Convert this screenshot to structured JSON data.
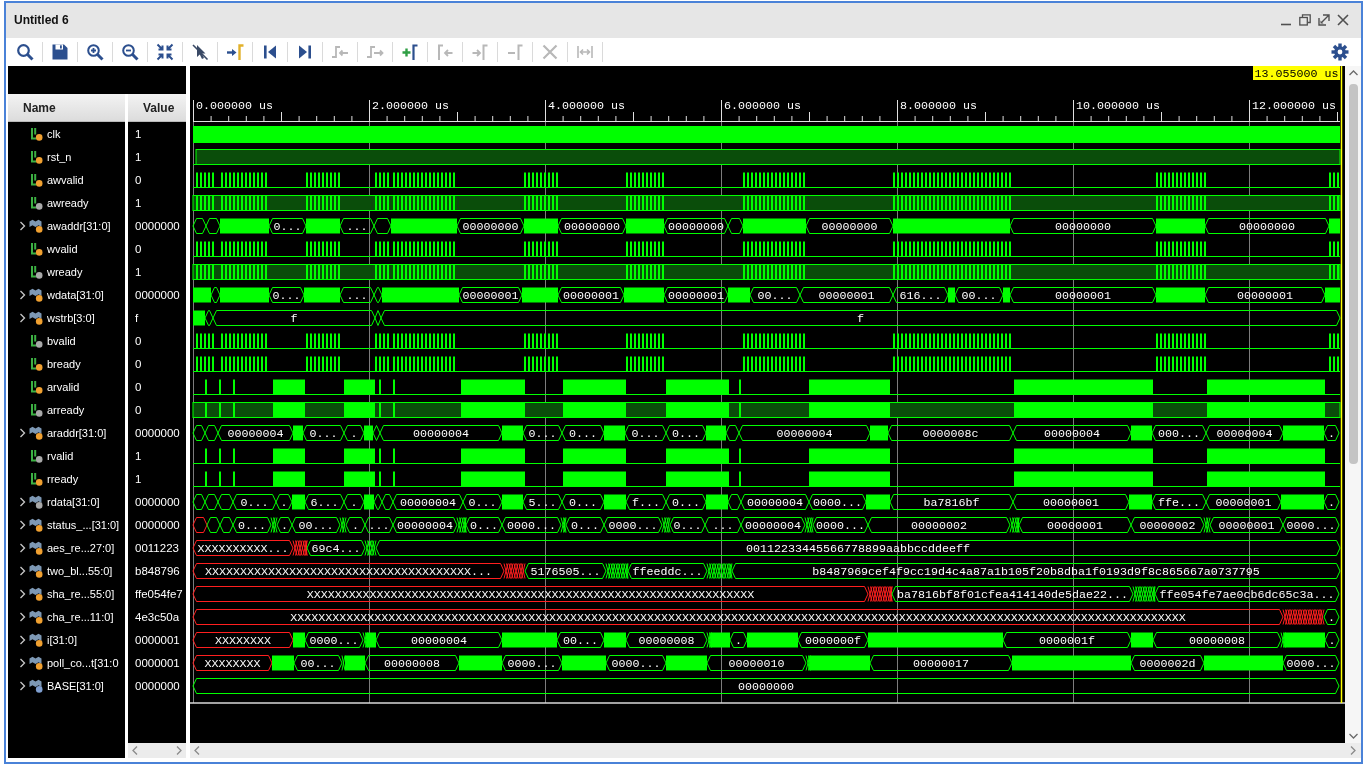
{
  "window": {
    "title": "Untitled 6"
  },
  "toolbar": [
    {
      "kind": "search",
      "disabled": false
    },
    {
      "kind": "save",
      "disabled": false
    },
    {
      "kind": "zoomin",
      "disabled": false
    },
    {
      "kind": "zoomout",
      "disabled": false
    },
    {
      "kind": "fit",
      "disabled": false
    },
    {
      "kind": "snap",
      "disabled": false
    },
    {
      "kind": "cursor",
      "disabled": false
    },
    {
      "kind": "first",
      "disabled": false
    },
    {
      "kind": "last",
      "disabled": false
    },
    {
      "kind": "prevedge",
      "disabled": true
    },
    {
      "kind": "nextedge",
      "disabled": true
    },
    {
      "kind": "addmarker",
      "disabled": false
    },
    {
      "kind": "prevmarker",
      "disabled": true
    },
    {
      "kind": "nextmarker",
      "disabled": true
    },
    {
      "kind": "removemarker",
      "disabled": true
    },
    {
      "kind": "clear",
      "disabled": true
    },
    {
      "kind": "distance",
      "disabled": true
    },
    {
      "kind": "settings",
      "disabled": false
    }
  ],
  "columns": {
    "name": "Name",
    "value": "Value"
  },
  "ruler": {
    "labels": [
      "0.000000 us",
      "2.000000 us",
      "4.000000 us",
      "6.000000 us",
      "8.000000 us",
      "10.000000 us",
      "12.000000 us"
    ],
    "cursor": "13.055000 us"
  },
  "signals": [
    {
      "name": "clk",
      "value": "1",
      "kind": "clock",
      "color": "#f0a030",
      "selected": false
    },
    {
      "name": "rst_n",
      "value": "1",
      "kind": "high",
      "color": "#f0a030",
      "selected": false
    },
    {
      "name": "awvalid",
      "value": "0",
      "kind": "bursts",
      "color": "#f0a030",
      "selected": false
    },
    {
      "name": "awready",
      "value": "1",
      "kind": "burstshigh",
      "color": "#a8a8a8",
      "selected": false
    },
    {
      "name": "awaddr[31:0]",
      "value": "0000000",
      "kind": "bus",
      "color": "#f0a030",
      "selected": false,
      "segments": [
        {
          "label": "0...",
          "kind": "valid"
        },
        {
          "label": "...",
          "kind": "valid"
        },
        {
          "label": "00000000",
          "kind": "valid"
        },
        {
          "label": "00000000",
          "kind": "valid"
        },
        {
          "label": "00000000",
          "kind": "valid"
        },
        {
          "label": "00000000",
          "kind": "valid"
        },
        {
          "label": "00000000",
          "kind": "valid"
        },
        {
          "label": "00000000",
          "kind": "valid"
        }
      ]
    },
    {
      "name": "wvalid",
      "value": "0",
      "kind": "bursts",
      "color": "#f0a030",
      "selected": false
    },
    {
      "name": "wready",
      "value": "1",
      "kind": "burstshigh",
      "color": "#a8a8a8",
      "selected": false
    },
    {
      "name": "wdata[31:0]",
      "value": "0000000",
      "kind": "bus",
      "color": "#f0a030",
      "selected": false,
      "segments": [
        {
          "label": "0...",
          "kind": "valid"
        },
        {
          "label": "...",
          "kind": "valid"
        },
        {
          "label": "00000001",
          "kind": "valid"
        },
        {
          "label": "00000001",
          "kind": "valid"
        },
        {
          "label": "00000001",
          "kind": "valid"
        },
        {
          "label": "00...",
          "kind": "valid"
        },
        {
          "label": "00000001",
          "kind": "valid"
        },
        {
          "label": "616...",
          "kind": "valid"
        },
        {
          "label": "00...",
          "kind": "valid"
        },
        {
          "label": "00000001",
          "kind": "valid"
        },
        {
          "label": "00000001",
          "kind": "valid"
        }
      ]
    },
    {
      "name": "wstrb[3:0]",
      "value": "f",
      "kind": "bus",
      "color": "#f0a030",
      "selected": false,
      "segments": [
        {
          "label": "f",
          "kind": "valid"
        },
        {
          "label": "f",
          "kind": "valid"
        }
      ]
    },
    {
      "name": "bvalid",
      "value": "0",
      "kind": "bursts",
      "color": "#a8a8a8",
      "selected": false
    },
    {
      "name": "bready",
      "value": "0",
      "kind": "bursts",
      "color": "#f0a030",
      "selected": false
    },
    {
      "name": "arvalid",
      "value": "0",
      "kind": "blocks",
      "color": "#f0a030",
      "selected": false
    },
    {
      "name": "arready",
      "value": "0",
      "kind": "blockshigh",
      "color": "#a8a8a8",
      "selected": false
    },
    {
      "name": "araddr[31:0]",
      "value": "0000000",
      "kind": "bus",
      "color": "#f0a030",
      "selected": false,
      "segments": [
        {
          "label": "00000004",
          "kind": "valid"
        },
        {
          "label": "0...",
          "kind": "valid"
        },
        {
          "label": ".",
          "kind": "valid"
        },
        {
          "label": "00000004",
          "kind": "valid"
        },
        {
          "label": "0...",
          "kind": "valid"
        },
        {
          "label": "0...",
          "kind": "valid"
        },
        {
          "label": "0...",
          "kind": "valid"
        },
        {
          "label": "0...",
          "kind": "valid"
        },
        {
          "label": "00000004",
          "kind": "valid"
        },
        {
          "label": "0000008c",
          "kind": "valid"
        },
        {
          "label": "00000004",
          "kind": "valid"
        },
        {
          "label": "000...",
          "kind": "valid"
        },
        {
          "label": "00000004",
          "kind": "valid"
        },
        {
          "label": ".",
          "kind": "valid"
        }
      ]
    },
    {
      "name": "rvalid",
      "value": "1",
      "kind": "blocks",
      "color": "#a8a8a8",
      "selected": false
    },
    {
      "name": "rready",
      "value": "1",
      "kind": "blocks",
      "color": "#f0a030",
      "selected": false
    },
    {
      "name": "rdata[31:0]",
      "value": "0000000",
      "kind": "bus",
      "color": "#a8a8a8",
      "selected": false,
      "segments": [
        {
          "label": "0...",
          "kind": "valid"
        },
        {
          "label": ".",
          "kind": "valid"
        },
        {
          "label": "6...",
          "kind": "valid"
        },
        {
          "label": ".",
          "kind": "valid"
        },
        {
          "label": "00000004",
          "kind": "valid"
        },
        {
          "label": "0...",
          "kind": "valid"
        },
        {
          "label": "5...",
          "kind": "valid"
        },
        {
          "label": "0...",
          "kind": "valid"
        },
        {
          "label": "f...",
          "kind": "valid"
        },
        {
          "label": "0...",
          "kind": "valid"
        },
        {
          "label": "00000004",
          "kind": "valid"
        },
        {
          "label": "0000...",
          "kind": "valid"
        },
        {
          "label": "ba7816bf",
          "kind": "valid"
        },
        {
          "label": "00000001",
          "kind": "valid"
        },
        {
          "label": "ffe...",
          "kind": "valid"
        },
        {
          "label": "00000001",
          "kind": "valid"
        },
        {
          "label": ".",
          "kind": "valid"
        }
      ]
    },
    {
      "name": "status_...[31:0]",
      "value": "0000000",
      "kind": "bus",
      "color": "#f0a030",
      "selected": false,
      "segments": [
        {
          "label": "0...",
          "kind": "valid"
        },
        {
          "label": ".",
          "kind": "valid"
        },
        {
          "label": "00...",
          "kind": "valid"
        },
        {
          "label": ".",
          "kind": "valid"
        },
        {
          "label": "...",
          "kind": "valid"
        },
        {
          "label": "00000004",
          "kind": "valid"
        },
        {
          "label": "0...",
          "kind": "valid"
        },
        {
          "label": "0000...",
          "kind": "valid"
        },
        {
          "label": "0...",
          "kind": "valid"
        },
        {
          "label": "0000...",
          "kind": "valid"
        },
        {
          "label": "0...",
          "kind": "valid"
        },
        {
          "label": "...",
          "kind": "valid"
        },
        {
          "label": "00000004",
          "kind": "valid"
        },
        {
          "label": "0000...",
          "kind": "valid"
        },
        {
          "label": "00000002",
          "kind": "valid"
        },
        {
          "label": "00000001",
          "kind": "valid"
        },
        {
          "label": "00000002",
          "kind": "valid"
        },
        {
          "label": "00000001",
          "kind": "valid"
        },
        {
          "label": "0000...",
          "kind": "valid"
        }
      ]
    },
    {
      "name": "aes_re...27:0]",
      "value": "0011223",
      "kind": "bus",
      "color": "#f0a030",
      "selected": false,
      "segments": [
        {
          "label": "XXXXXXXXXX...",
          "kind": "unknown"
        },
        {
          "label": "69c4...",
          "kind": "valid"
        },
        {
          "label": "00112233445566778899aabbccddeeff",
          "kind": "valid"
        }
      ]
    },
    {
      "name": "two_bl...55:0]",
      "value": "b848796",
      "kind": "bus",
      "color": "#f0a030",
      "selected": false,
      "segments": [
        {
          "label": "XXXXXXXXXXXXXXXXXXXXXXXXXXXXXXXXXXXXXX...",
          "kind": "unknown"
        },
        {
          "label": "5176505...",
          "kind": "valid"
        },
        {
          "label": "ffeeddc...",
          "kind": "valid"
        },
        {
          "label": "b8487969cef4f9cc19d4c4a87a1b105f20b8dba1f0193d9f8c865667a0737795",
          "kind": "valid"
        }
      ]
    },
    {
      "name": "sha_re...55:0]",
      "value": "ffe054fe7",
      "kind": "bus",
      "color": "#f0a030",
      "selected": false,
      "segments": [
        {
          "label": "XXXXXXXXXXXXXXXXXXXXXXXXXXXXXXXXXXXXXXXXXXXXXXXXXXXXXXXXXXXXXXXX",
          "kind": "unknown"
        },
        {
          "label": "ba7816bf8f01cfea414140de5dae22...",
          "kind": "valid"
        },
        {
          "label": "ffe054fe7ae0cb6dc65c3a...",
          "kind": "valid"
        }
      ]
    },
    {
      "name": "cha_re...11:0]",
      "value": "4e3c50a",
      "kind": "bus",
      "color": "#f0a030",
      "selected": false,
      "segments": [
        {
          "label": "XXXXXXXXXXXXXXXXXXXXXXXXXXXXXXXXXXXXXXXXXXXXXXXXXXXXXXXXXXXXXXXXXXXXXXXXXXXXXXXXXXXXXXXXXXXXXXXXXXXXXXXXXXXXXXXXXXXXXXXXXXXXXXXX",
          "kind": "unknown"
        },
        {
          "label": ".",
          "kind": "valid"
        }
      ]
    },
    {
      "name": "i[31:0]",
      "value": "0000001",
      "kind": "bus",
      "color": "#f0a030",
      "selected": false,
      "segments": [
        {
          "label": "XXXXXXXX",
          "kind": "unknown"
        },
        {
          "label": "0000...",
          "kind": "valid"
        },
        {
          "label": "00000004",
          "kind": "valid"
        },
        {
          "label": "00...",
          "kind": "valid"
        },
        {
          "label": "00000008",
          "kind": "valid"
        },
        {
          "label": ".",
          "kind": "valid"
        },
        {
          "label": "0000000f",
          "kind": "valid"
        },
        {
          "label": "0000001f",
          "kind": "valid"
        },
        {
          "label": "00000008",
          "kind": "valid"
        },
        {
          "label": ".",
          "kind": "valid"
        }
      ]
    },
    {
      "name": "poll_co...t[31:0",
      "value": "0000001",
      "kind": "bus",
      "color": "#f0a030",
      "selected": false,
      "segments": [
        {
          "label": "XXXXXXXX",
          "kind": "unknown"
        },
        {
          "label": "00...",
          "kind": "valid"
        },
        {
          "label": "00000008",
          "kind": "valid"
        },
        {
          "label": "0000...",
          "kind": "valid"
        },
        {
          "label": "0000...",
          "kind": "valid"
        },
        {
          "label": "00000010",
          "kind": "valid"
        },
        {
          "label": "00000017",
          "kind": "valid"
        },
        {
          "label": "0000002d",
          "kind": "valid"
        },
        {
          "label": "0000...",
          "kind": "valid"
        }
      ]
    },
    {
      "name": "BASE[31:0]",
      "value": "0000000",
      "kind": "bus",
      "color": "#7f9fd0",
      "selected": false,
      "segments": [
        {
          "label": "00000000",
          "kind": "valid"
        }
      ]
    }
  ]
}
